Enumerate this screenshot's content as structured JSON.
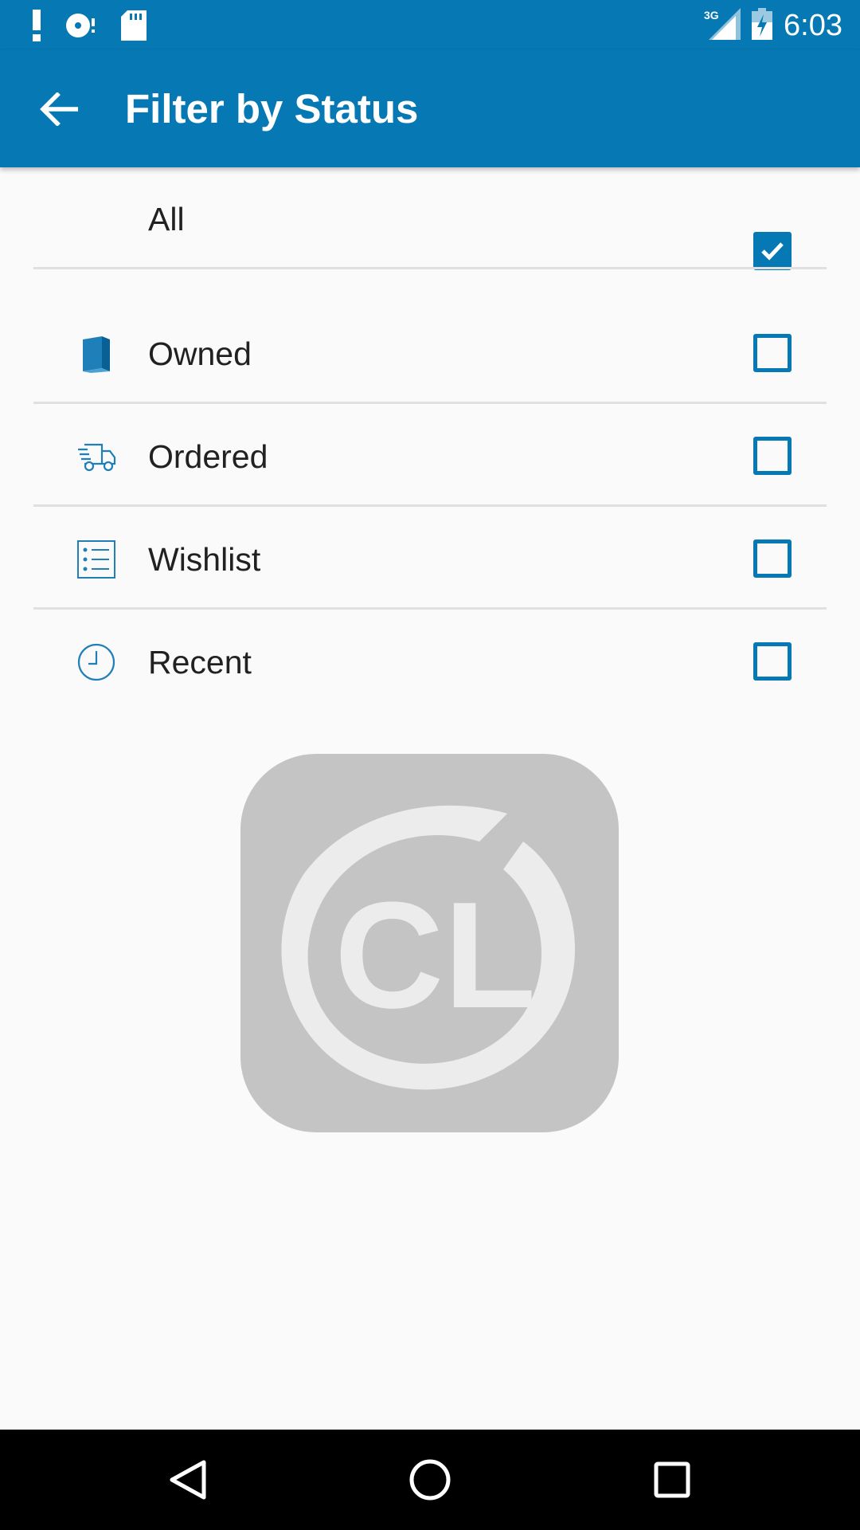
{
  "status_bar": {
    "time": "6:03",
    "network": "3G",
    "icons": [
      "alert-icon",
      "disc-icon",
      "sd-card-icon",
      "signal-icon",
      "battery-charging-icon"
    ]
  },
  "app_bar": {
    "title": "Filter by Status",
    "back_icon": "arrow-back-icon"
  },
  "filters": [
    {
      "label": "All",
      "icon": "",
      "checked": true
    },
    {
      "label": "Owned",
      "icon": "book-icon",
      "checked": false
    },
    {
      "label": "Ordered",
      "icon": "truck-icon",
      "checked": false
    },
    {
      "label": "Wishlist",
      "icon": "wishlist-icon",
      "checked": false
    },
    {
      "label": "Recent",
      "icon": "clock-icon",
      "checked": false
    }
  ],
  "logo": {
    "icon": "cl-logo",
    "text": "CL"
  },
  "nav_bar": {
    "icons": [
      "back-triangle-icon",
      "home-circle-icon",
      "recents-square-icon"
    ]
  },
  "colors": {
    "primary": "#0678b3",
    "background": "#fafafa",
    "divider": "#e0e0e0",
    "logo_gray": "#c4c4c4"
  }
}
